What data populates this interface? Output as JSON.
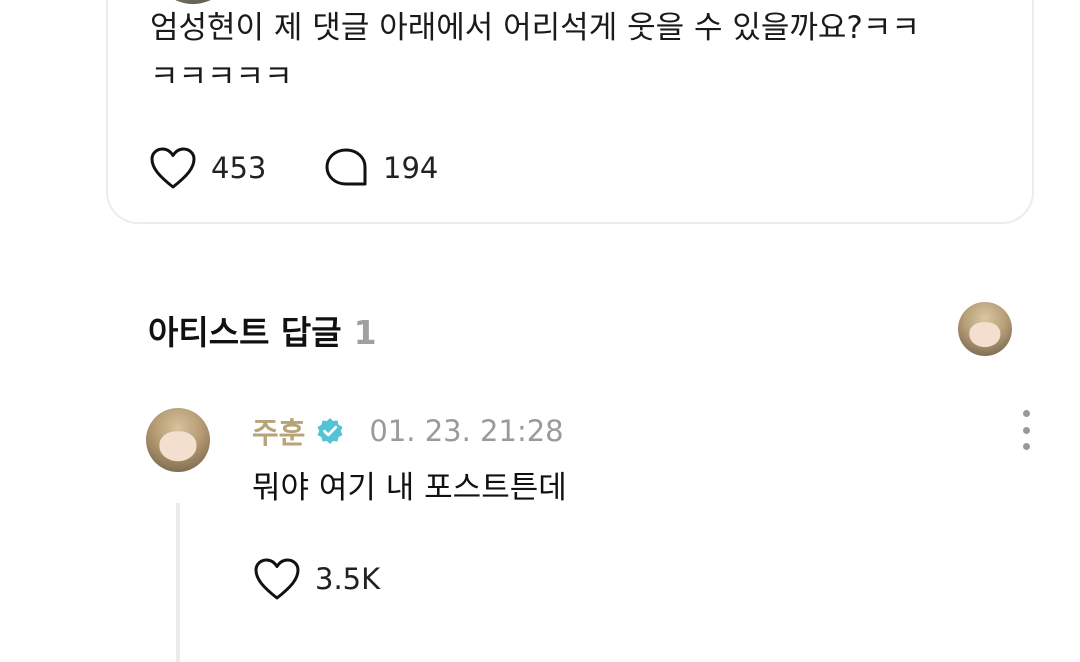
{
  "comment": {
    "text_line1": "엄성현이 제 댓글 아래에서 어리석게 웃을 수 있을까요?ㅋㅋ",
    "text_line2": "ㅋㅋㅋㅋㅋ",
    "like_count": "453",
    "reply_count": "194"
  },
  "artist_replies": {
    "title": "아티스트 답글",
    "count": "1"
  },
  "reply": {
    "author": "주훈",
    "timestamp": "01. 23. 21:28",
    "text": "뭐야 여기 내 포스트튼데",
    "like_count": "3.5K"
  },
  "colors": {
    "author_name": "#b8a277",
    "verified_badge": "#55c2d6",
    "muted_text": "#9a9a9a",
    "card_border": "#ececec"
  },
  "icons": [
    "heart-icon",
    "comment-bubble-icon",
    "verified-badge-icon",
    "more-vertical-icon"
  ]
}
